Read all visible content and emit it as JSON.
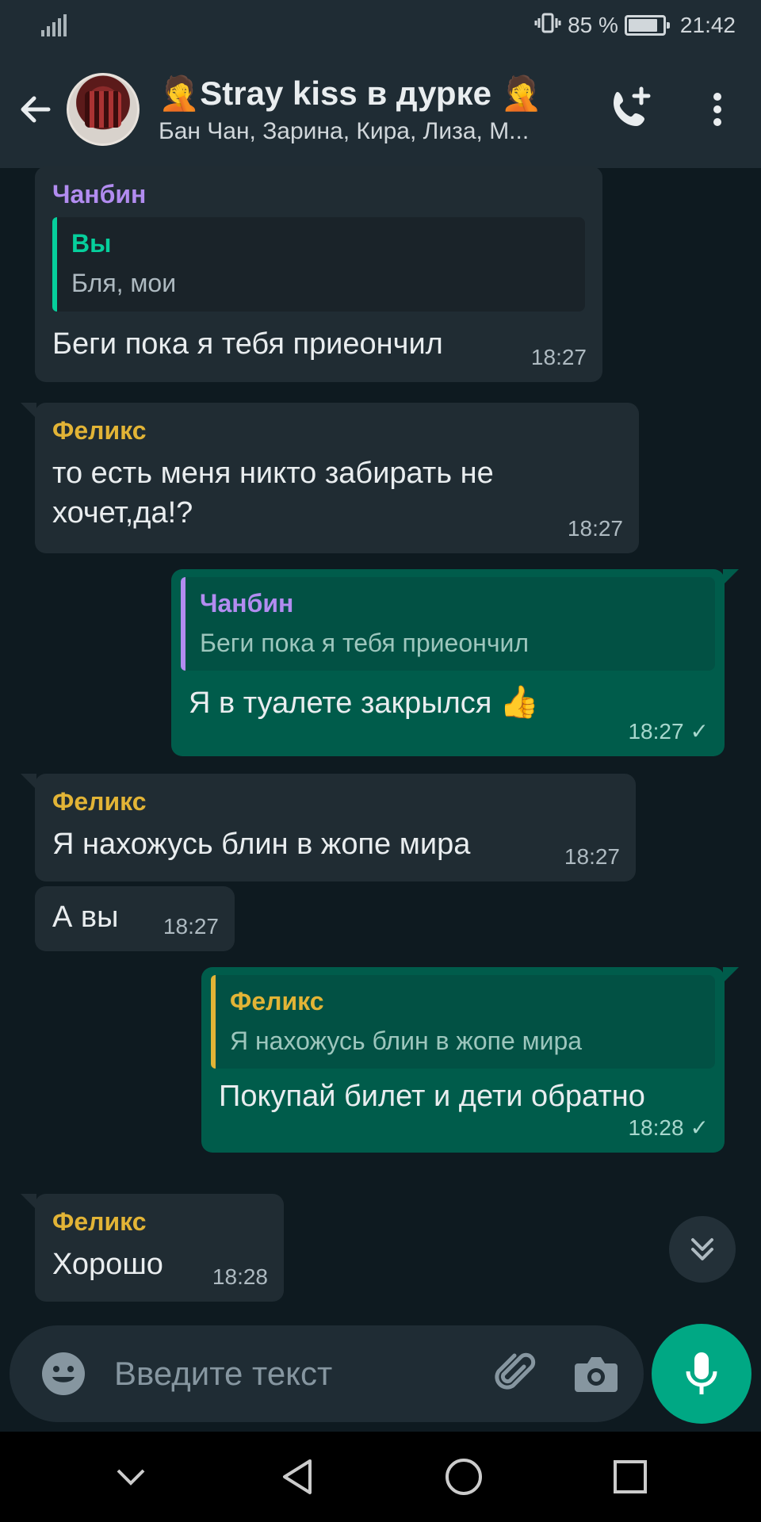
{
  "status_bar": {
    "battery": "85 %",
    "time": "21:42",
    "battery_level": 0.85
  },
  "header": {
    "title": "🤦Stray kiss в дурке 🤦",
    "subtitle": "Бан Чан, Зарина, Кира, Лиза, М..."
  },
  "messages": [
    {
      "sender": "Чанбин",
      "quote_name": "Вы",
      "quote_text": "Бля, мои",
      "text": "Беги пока я тебя приеончил",
      "time": "18:27"
    },
    {
      "sender": "Феликс",
      "text_1": "то есть меня никто забирать не",
      "text_2": "хочет,да!?",
      "time": "18:27"
    },
    {
      "quote_name": "Чанбин",
      "quote_text": "Беги пока я тебя приеончил",
      "text": "Я в туалете закрылся",
      "emoji": "👍",
      "time": "18:27",
      "check": "✓"
    },
    {
      "sender": "Феликс",
      "text": "Я нахожусь блин в жопе мира",
      "time": "18:27"
    },
    {
      "text": "А вы",
      "time": "18:27"
    },
    {
      "quote_name": "Феликс",
      "quote_text": "Я нахожусь блин в жопе мира",
      "text": "Покупай билет и дети обратно",
      "time": "18:28",
      "check": "✓"
    },
    {
      "sender": "Феликс",
      "text": "Хорошо",
      "time": "18:28"
    }
  ],
  "input": {
    "placeholder": "Введите текст"
  },
  "icons": {
    "back": "arrow-left-icon",
    "add_call": "add-call-icon",
    "menu": "more-vert-icon",
    "emoji": "emoji-icon",
    "attach": "paperclip-icon",
    "camera": "camera-icon",
    "mic": "mic-icon",
    "scroll": "double-chevron-down-icon"
  },
  "colors": {
    "accent": "#00a884",
    "outgoing": "#005c4b",
    "incoming": "#202c33",
    "felix": "#e2b436",
    "chanbin": "#b28cf0",
    "me": "#06cf9c"
  }
}
